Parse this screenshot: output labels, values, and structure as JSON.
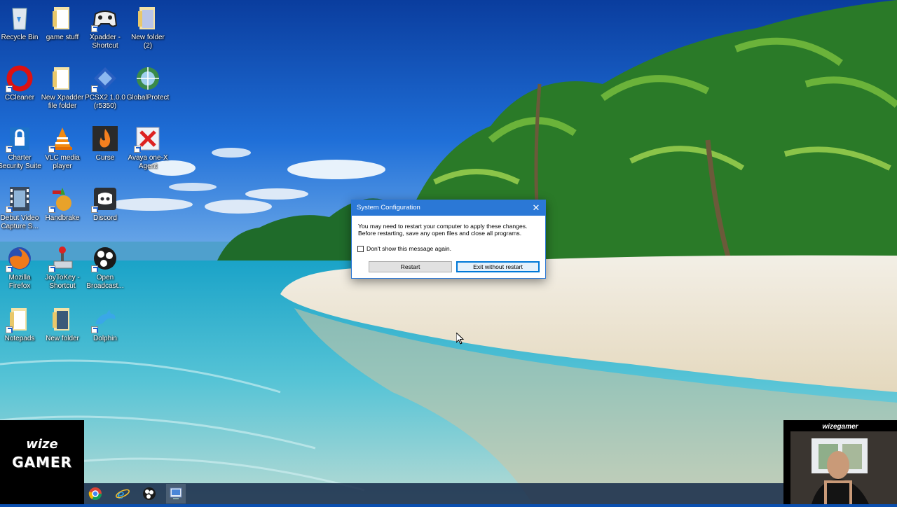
{
  "dialog": {
    "title": "System Configuration",
    "close_glyph": "✕",
    "message_line1": "You may need to restart your computer to apply these changes.",
    "message_line2": "Before restarting, save any open files and close all programs.",
    "checkbox_label": "Don't show this message again.",
    "checkbox_checked": false,
    "restart_label": "Restart",
    "exit_label": "Exit without restart"
  },
  "desktop_icons": [
    {
      "label": "Recycle Bin",
      "icon": "recycle-bin-icon"
    },
    {
      "label": "game stuff",
      "icon": "folder-icon"
    },
    {
      "label": "Xpadder - Shortcut",
      "icon": "gamepad-icon"
    },
    {
      "label": "New folder (2)",
      "icon": "folder-icon"
    },
    {
      "label": "CCleaner",
      "icon": "ccleaner-icon"
    },
    {
      "label": "New Xpadder file folder",
      "icon": "folder-icon"
    },
    {
      "label": "PCSX2 1.0.0 (r5350)",
      "icon": "pcsx2-icon"
    },
    {
      "label": "GlobalProtect",
      "icon": "globe-icon"
    },
    {
      "label": "Charter Security Suite",
      "icon": "lock-icon"
    },
    {
      "label": "VLC media player",
      "icon": "vlc-cone-icon"
    },
    {
      "label": "Curse",
      "icon": "flame-icon"
    },
    {
      "label": "Avaya one-X Agent",
      "icon": "avaya-icon"
    },
    {
      "label": "Debut Video Capture S...",
      "icon": "film-icon"
    },
    {
      "label": "Handbrake",
      "icon": "pineapple-icon"
    },
    {
      "label": "Discord",
      "icon": "discord-icon"
    },
    {
      "label": "Mozilla Firefox",
      "icon": "firefox-icon"
    },
    {
      "label": "JoyToKey - Shortcut",
      "icon": "joystick-icon"
    },
    {
      "label": "Open Broadcast...",
      "icon": "obs-icon"
    },
    {
      "label": "Notepads",
      "icon": "folder-icon"
    },
    {
      "label": "New folder",
      "icon": "folder-icon"
    },
    {
      "label": "Dolphin",
      "icon": "dolphin-icon"
    }
  ],
  "taskbar_icons": [
    "chrome-icon",
    "internet-explorer-icon",
    "obs-icon",
    "system-config-icon"
  ],
  "overlay": {
    "logo_top": "wize",
    "logo_bottom": "GAMER",
    "webcam_name": "wizegamer"
  }
}
